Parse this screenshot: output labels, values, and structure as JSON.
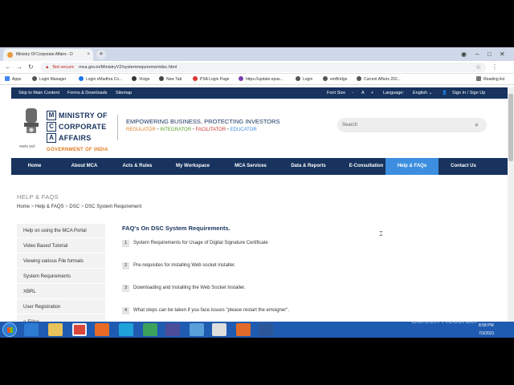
{
  "browser": {
    "tab_title": "Ministry Of Corporate Affairs - D",
    "tab_close": "×",
    "new_tab": "+",
    "url_warning": "Not secure",
    "url": "mca.gov.in/MinistryV2/systemrequirementdsc.html",
    "bookmarks": [
      "Apps",
      "Login Manager",
      "Login eMudhra Co...",
      "Visign",
      "New Tab",
      "PSA Login Page",
      "https://update.epas...",
      "Login",
      "emBridge",
      "Current Affairs 202..."
    ],
    "reading_list": "Reading list"
  },
  "topstrip": {
    "skip": "Skip to Main Content",
    "forms": "Forms & Downloads",
    "sitemap": "Sitemap",
    "font_size": "Font Size",
    "font_minus": "-",
    "font_a": "A",
    "font_plus": "+",
    "language_label": "Language:",
    "language_value": "English",
    "signin": "Sign In / Sign Up"
  },
  "header": {
    "logo_letters": [
      "M",
      "C",
      "A"
    ],
    "logo_words": [
      "MINISTRY OF",
      "CORPORATE",
      "AFFAIRS"
    ],
    "gov": "GOVERNMENT OF INDIA",
    "emblem_caption": "सत्यमेव जयते",
    "tagline": "EMPOWERING BUSINESS, PROTECTING INVESTORS",
    "roles": [
      "REGULATOR",
      "INTEGRATOR",
      "FACILITATOR",
      "EDUCATOR"
    ],
    "search_placeholder": "Search"
  },
  "nav": [
    "Home",
    "About MCA",
    "Acts & Rules",
    "My Workspace",
    "MCA Services",
    "Data & Reports",
    "E-Consultation",
    "Help & FAQs",
    "Contact Us"
  ],
  "page": {
    "section_title": "HELP & FAQS",
    "breadcrumb": [
      "Home",
      "Help & FAQS",
      "DSC",
      "DSC System Requirement"
    ],
    "sidebar": [
      "Help on using the MCA Portal",
      "Video Based Tutorial",
      "Viewing various File formats",
      "System Requirements",
      "XBRL",
      "User Registration",
      "e-Filing"
    ],
    "faq_title": "FAQ's On DSC System Requirements.",
    "faqs": [
      {
        "num": "1",
        "text": "System Requirements for Usage of Digital Signature Certificate"
      },
      {
        "num": "2",
        "text": "Pre-requisites for installing Web socket installer."
      },
      {
        "num": "3",
        "text": "Downloading and Installing the Web Socket Installer."
      },
      {
        "num": "4",
        "text": "What steps can be taken if you face issues \"please restart the emsigner\"."
      }
    ]
  },
  "taskbar": {
    "time": "8:58 PM",
    "date": "7/3/2021",
    "watermark": "Screen Recorder"
  },
  "colors": {
    "navy": "#17335e",
    "nav_active": "#3d8ee0",
    "regulator": "#e07a1f",
    "integrator": "#5aa02c",
    "facilitator": "#d0312d",
    "educator": "#3d8ee0",
    "taskbar": "#1f5bb0"
  }
}
